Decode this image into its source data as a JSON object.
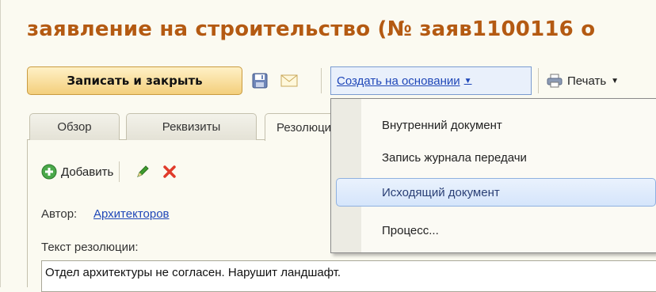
{
  "window": {
    "title": "заявление на строительство (№ заяв1100116 о"
  },
  "toolbar": {
    "save_close_label": "Записать и закрыть",
    "save_icon": "floppy-disk-icon",
    "mail_icon": "envelope-icon",
    "create_based_label": "Создать на основании",
    "print_label": "Печать",
    "print_icon": "printer-icon"
  },
  "tabs": [
    {
      "label": "Обзор"
    },
    {
      "label": "Реквизиты"
    },
    {
      "label": "Резолюции",
      "active": true
    }
  ],
  "resolution": {
    "add_label": "Добавить",
    "edit_icon": "pencil-icon",
    "delete_icon": "delete-x-icon",
    "author_label": "Автор:",
    "author_value": "Архитекторов",
    "text_label": "Текст резолюции:",
    "text_value": "Отдел архитектуры не согласен. Нарушит ландшафт."
  },
  "create_menu": {
    "items": [
      {
        "label": "Внутренний документ"
      },
      {
        "label": "Запись журнала передачи"
      },
      {
        "label": "Исходящий документ",
        "highlighted": true
      },
      {
        "label": "Процесс..."
      }
    ]
  },
  "colors": {
    "title": "#b45a12",
    "primary_button": "#f3cf7c",
    "link": "#1f47b8",
    "menu_highlight": "#d5e5fb"
  }
}
